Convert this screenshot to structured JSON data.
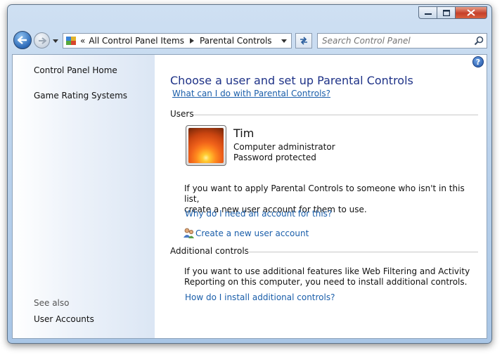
{
  "navigation": {
    "breadcrumb": [
      "All Control Panel Items",
      "Parental Controls"
    ],
    "breadcrumb_overflow": "«",
    "search_placeholder": "Search Control Panel"
  },
  "sidebar": {
    "links": [
      "Control Panel Home",
      "Game Rating Systems"
    ],
    "see_also_heading": "See also",
    "see_also_links": [
      "User Accounts"
    ]
  },
  "main": {
    "title": "Choose a user and set up Parental Controls",
    "help_link": "What can I do with Parental Controls?",
    "users_section": "Users",
    "user": {
      "name": "Tim",
      "role": "Computer administrator",
      "status": "Password protected"
    },
    "apply_text_line1": "If you want to apply Parental Controls to someone who isn't in this list,",
    "apply_text_line2": "create a new user account for them to use.",
    "why_link": "Why do I need an account for this?",
    "create_link": "Create a new user account",
    "additional_section": "Additional controls",
    "additional_text_line1": "If you want to use additional features like Web Filtering and Activity",
    "additional_text_line2": "Reporting on this computer, you need to install additional controls.",
    "install_link": "How do I install additional controls?"
  },
  "icons": {
    "back": "back-arrow-icon",
    "forward": "forward-arrow-icon",
    "help": "help-icon",
    "search": "search-icon",
    "refresh": "refresh-icon",
    "control_panel": "control-panel-icon",
    "users": "users-icon"
  },
  "colors": {
    "title": "#1e3287",
    "link": "#1a5eaa",
    "close_button": "#c6402a"
  }
}
